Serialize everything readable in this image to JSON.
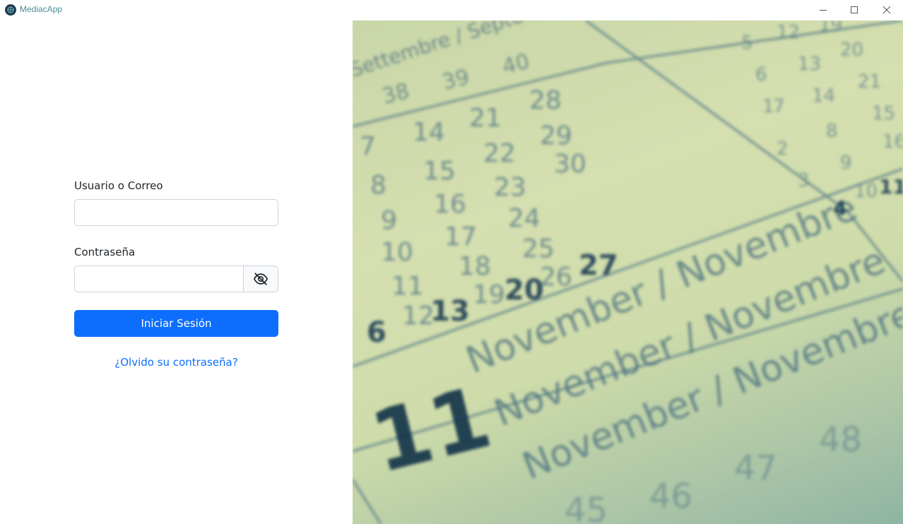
{
  "window": {
    "title": "MediacApp",
    "logo_icon": "app-logo-icon",
    "controls": [
      "minimize-icon",
      "maximize-icon",
      "close-icon"
    ]
  },
  "login": {
    "username_label": "Usuario o Correo",
    "username_value": "",
    "password_label": "Contraseña",
    "password_value": "",
    "toggle_icon": "eye-slash-icon",
    "submit_label": "Iniciar Sesión",
    "forgot_link": "¿Olvido su contraseña?"
  },
  "hero_image": {
    "description_icon": "calendar-photo",
    "month_labels": [
      "September / Settembre",
      "November / Novembre"
    ],
    "highlight_numbers": [
      "6",
      "13",
      "20",
      "27",
      "11"
    ]
  },
  "colors": {
    "primary": "#0d6efd",
    "app_title": "#4a8a99",
    "border": "#ced4da"
  }
}
